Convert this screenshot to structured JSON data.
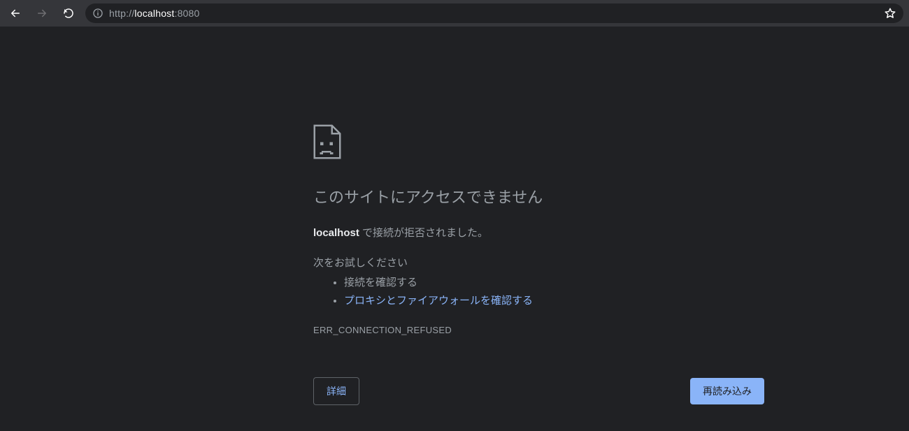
{
  "toolbar": {
    "url_protocol": "http://",
    "url_host": "localhost",
    "url_port": ":8080"
  },
  "error": {
    "title": "このサイトにアクセスできません",
    "message_host": "localhost",
    "message_rest": " で接続が拒否されました。",
    "try_label": "次をお試しください",
    "try_items": [
      "接続を確認する",
      "プロキシとファイアウォールを確認する"
    ],
    "code": "ERR_CONNECTION_REFUSED",
    "btn_details": "詳細",
    "btn_reload": "再読み込み"
  }
}
